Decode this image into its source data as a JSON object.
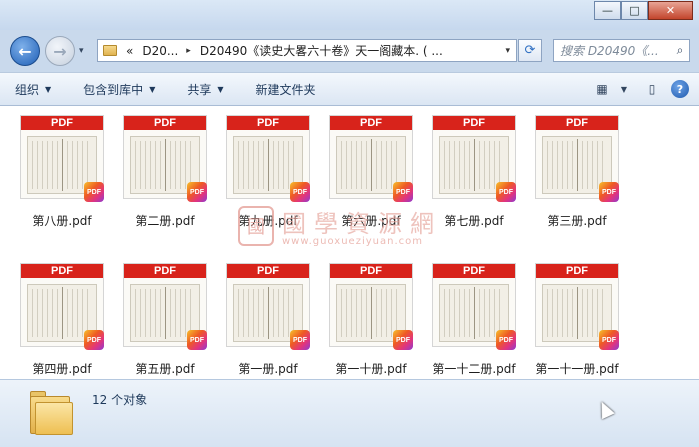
{
  "window": {
    "minimize_glyph": "—",
    "maximize_glyph": "□",
    "close_glyph": "✕"
  },
  "navigation": {
    "back_glyph": "←",
    "forward_glyph": "→",
    "history_glyph": "▾"
  },
  "address": {
    "chevrons": "«",
    "crumb_1": "D20...",
    "crumb_2": "D20490《读史大畧六十卷》天一阁藏本. ( ...",
    "separator": "▸",
    "dropdown": "▾",
    "refresh_glyph": "⟳"
  },
  "search": {
    "placeholder": "搜索 D20490《...",
    "icon": "search-icon",
    "icon_glyph": "⌕"
  },
  "toolbar": {
    "organize": "组织",
    "include_in_library": "包含到库中",
    "share": "共享",
    "new_folder": "新建文件夹",
    "caret": "▼",
    "view_glyph": "▦",
    "view_caret": "▼",
    "preview_glyph": "▯",
    "help_glyph": "?"
  },
  "files": [
    {
      "name": "第八册.pdf",
      "band": "PDF",
      "badge": "PDF"
    },
    {
      "name": "第二册.pdf",
      "band": "PDF",
      "badge": "PDF"
    },
    {
      "name": "第九册.pdf",
      "band": "PDF",
      "badge": "PDF"
    },
    {
      "name": "第六册.pdf",
      "band": "PDF",
      "badge": "PDF"
    },
    {
      "name": "第七册.pdf",
      "band": "PDF",
      "badge": "PDF"
    },
    {
      "name": "第三册.pdf",
      "band": "PDF",
      "badge": "PDF"
    },
    {
      "name": "第四册.pdf",
      "band": "PDF",
      "badge": "PDF"
    },
    {
      "name": "第五册.pdf",
      "band": "PDF",
      "badge": "PDF"
    },
    {
      "name": "第一册.pdf",
      "band": "PDF",
      "badge": "PDF"
    },
    {
      "name": "第一十册.pdf",
      "band": "PDF",
      "badge": "PDF"
    },
    {
      "name": "第一十二册.pdf",
      "band": "PDF",
      "badge": "PDF"
    },
    {
      "name": "第一十一册.pdf",
      "band": "PDF",
      "badge": "PDF"
    }
  ],
  "watermark": {
    "seal": "國",
    "title": "國學資源網",
    "url": "www.guoxueziyuan.com"
  },
  "status": {
    "item_count": "12 个对象"
  },
  "colors": {
    "pdf_band": "#d8231b",
    "toolbar_text": "#1e395b",
    "chrome": "#c9d9ec"
  }
}
